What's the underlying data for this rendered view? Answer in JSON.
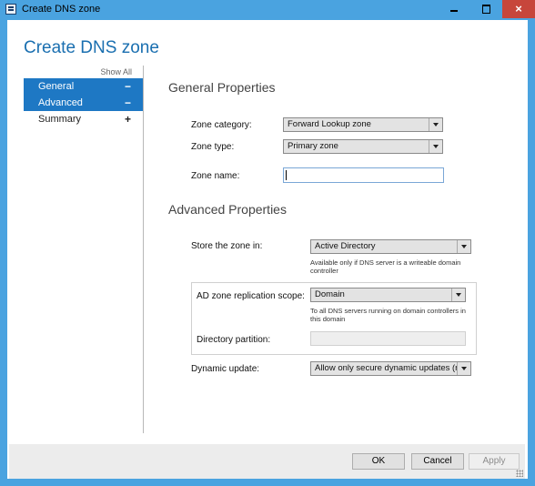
{
  "window": {
    "title": "Create DNS zone",
    "icon": "dns-manager-icon",
    "controls": {
      "minimize": "minimize-icon",
      "maximize": "maximize-icon",
      "close": "×"
    }
  },
  "header": {
    "title": "Create DNS zone"
  },
  "sidebar": {
    "show_all": "Show All",
    "items": [
      {
        "label": "General",
        "toggle": "−",
        "selected": true
      },
      {
        "label": "Advanced",
        "toggle": "−",
        "selected": true
      },
      {
        "label": "Summary",
        "toggle": "+",
        "selected": false
      }
    ]
  },
  "general": {
    "heading": "General Properties",
    "zone_category_label": "Zone category:",
    "zone_category_value": "Forward Lookup zone",
    "zone_type_label": "Zone type:",
    "zone_type_value": "Primary zone",
    "zone_name_label": "Zone name:",
    "zone_name_value": ""
  },
  "advanced": {
    "heading": "Advanced Properties",
    "store_label": "Store the zone in:",
    "store_value": "Active Directory",
    "store_note_line1": "Available only if DNS server is a writeable domain",
    "store_note_line2": "controller",
    "replication_label": "AD zone replication scope:",
    "replication_value": "Domain",
    "replication_note_line1": "To all DNS servers running on domain controllers in",
    "replication_note_line2": "this domain",
    "partition_label": "Directory partition:",
    "partition_value": "",
    "dynamic_label": "Dynamic update:",
    "dynamic_value": "Allow only secure dynamic updates (rec"
  },
  "footer": {
    "ok": "OK",
    "cancel": "Cancel",
    "apply": "Apply"
  },
  "colors": {
    "accent": "#1e78c4",
    "titlebar": "#4aa3e0",
    "close": "#c7463b",
    "heading": "#1a6fb0"
  }
}
